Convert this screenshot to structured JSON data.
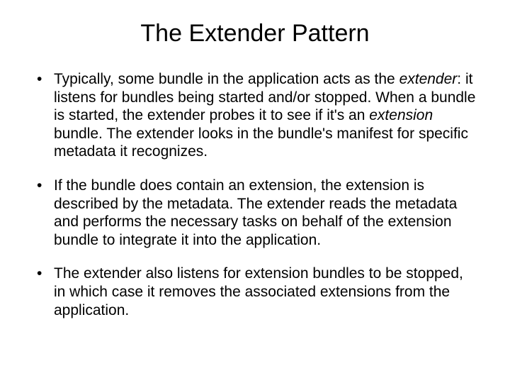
{
  "title": "The Extender Pattern",
  "bullets": [
    {
      "pre": "Typically, some bundle in the application acts as the ",
      "em1": "extender",
      "mid": ": it listens for bundles being started and/or stopped. When a bundle is started, the extender probes it to see if it's an ",
      "em2": "extension",
      "post": " bundle. The extender looks in the bundle's manifest for specific metadata it recognizes."
    },
    {
      "pre": "If the bundle does contain an extension, the extension is described by the metadata. The extender reads the metadata and performs the necessary tasks on behalf of the extension bundle to integrate it into the application.",
      "em1": "",
      "mid": "",
      "em2": "",
      "post": ""
    },
    {
      "pre": "The extender also listens for extension bundles to be stopped, in which case it removes the associated extensions from the application.",
      "em1": "",
      "mid": "",
      "em2": "",
      "post": ""
    }
  ]
}
